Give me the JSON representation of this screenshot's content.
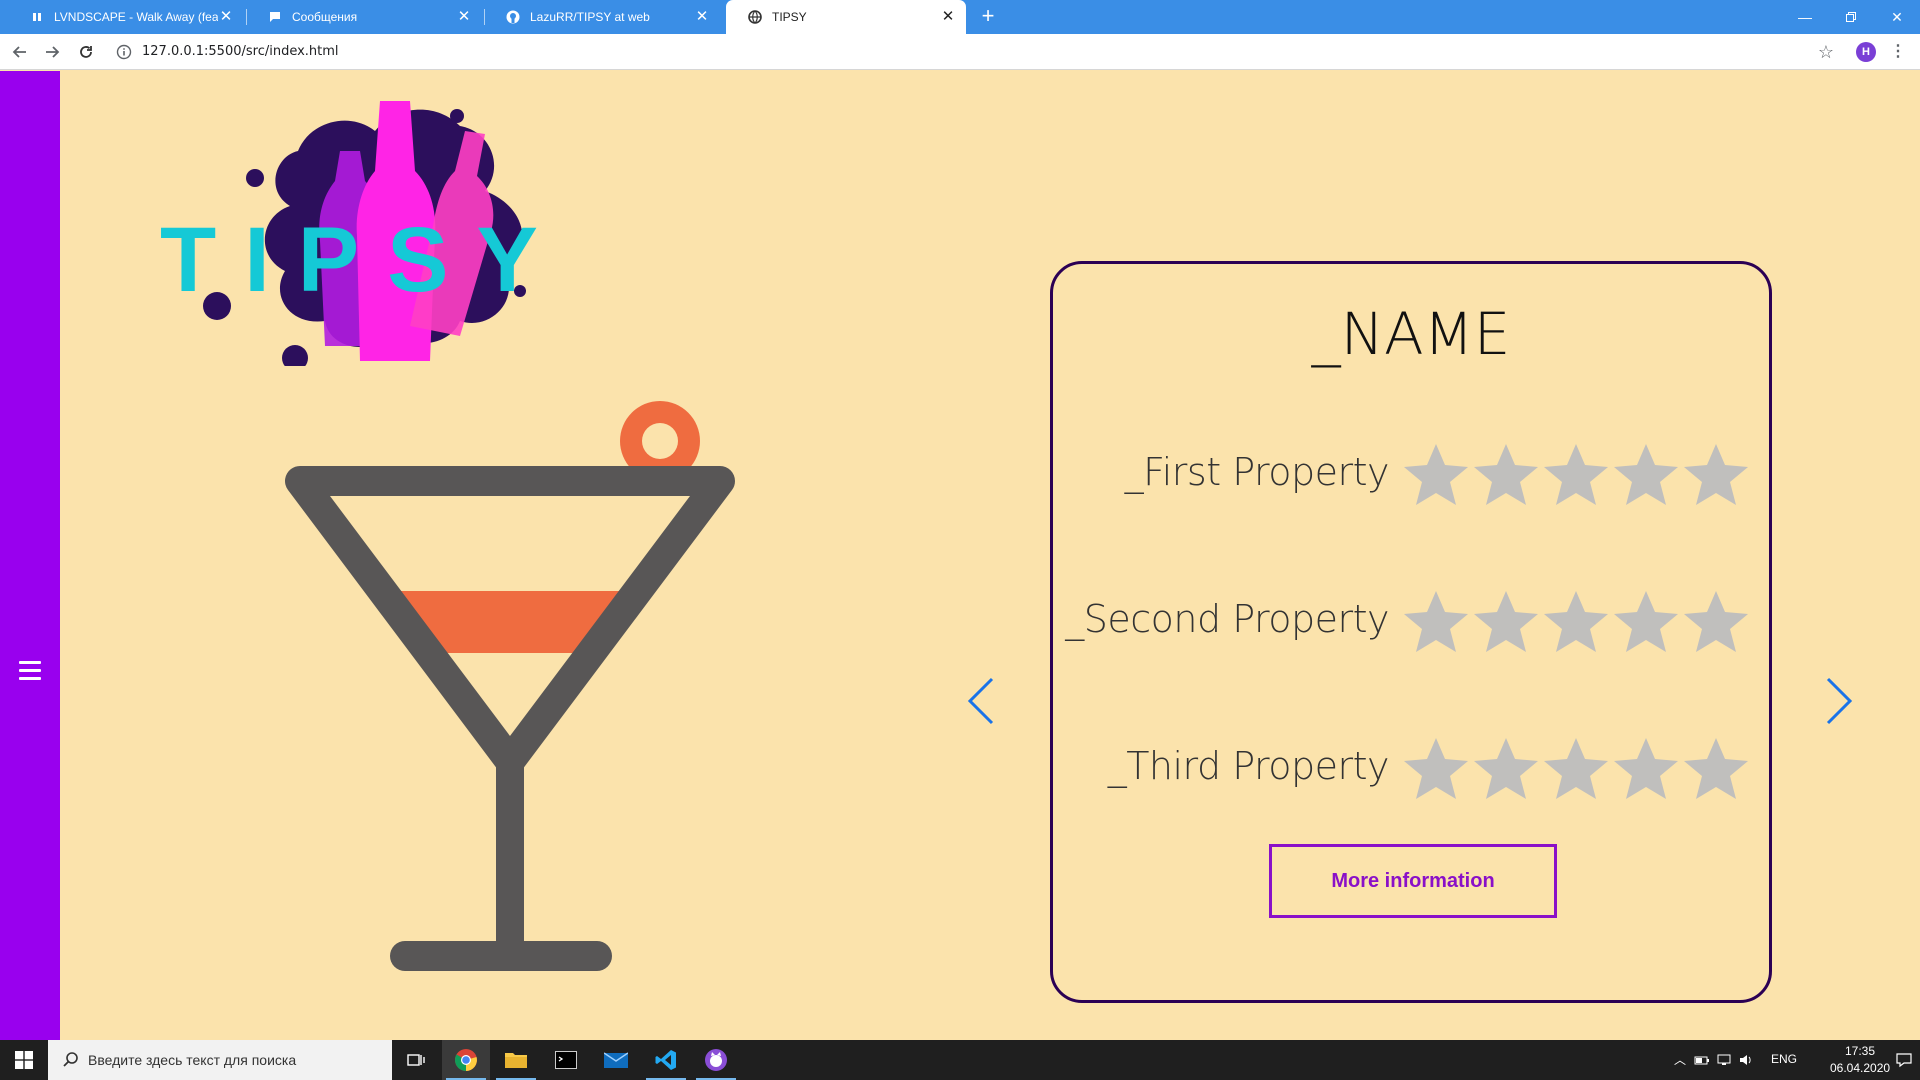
{
  "browser": {
    "tabs": [
      {
        "title": "LVNDSCAPE - Walk Away (feat. K",
        "icon": "pause-icon",
        "active": false
      },
      {
        "title": "Сообщения",
        "icon": "chat-icon",
        "active": false
      },
      {
        "title": "LazuRR/TIPSY at web",
        "icon": "github-icon",
        "active": false
      },
      {
        "title": "TIPSY",
        "icon": "globe-icon",
        "active": true
      }
    ],
    "new_tab_label": "+",
    "url": "127.0.0.1:5500/src/index.html",
    "profile_initial": "H"
  },
  "page": {
    "logo_text": "TIPSY",
    "card": {
      "name": "_NAME",
      "properties": [
        {
          "label": "_First Property",
          "rating": 0,
          "max": 5
        },
        {
          "label": "_Second Property",
          "rating": 0,
          "max": 5
        },
        {
          "label": "_Third Property",
          "rating": 0,
          "max": 5
        }
      ],
      "button_label": "More information"
    },
    "colors": {
      "background": "#fbe3ac",
      "sidebar": "#9900ee",
      "card_border": "#2b0054",
      "button": "#8a10c8",
      "star_empty": "#c0bfbd",
      "arrow": "#1a73e8"
    }
  },
  "taskbar": {
    "search_placeholder": "Введите здесь текст для поиска",
    "language": "ENG",
    "time": "17:35",
    "date": "06.04.2020"
  }
}
